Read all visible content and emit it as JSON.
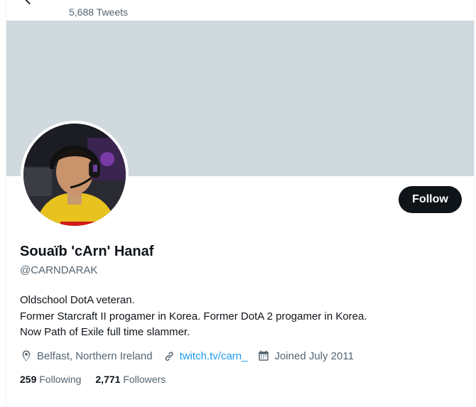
{
  "header": {
    "tweet_count": "5,688 Tweets",
    "back_icon": "arrow-left-icon"
  },
  "banner": {
    "color": "#cfd9de"
  },
  "profile": {
    "display_name": "Souaïb 'cArn' Hanaf",
    "handle": "@CARNDARAK",
    "follow_label": "Follow",
    "bio_lines": [
      "Oldschool DotA veteran.",
      "Former Starcraft II progamer in Korea. Former DotA 2 progamer in Korea.",
      "Now Path of Exile full time slammer."
    ],
    "location": "Belfast, Northern Ireland",
    "website": "twitch.tv/carn_",
    "joined": "Joined July 2011",
    "following_count": "259",
    "following_label": "Following",
    "followers_count": "2,771",
    "followers_label": "Followers"
  },
  "colors": {
    "accent_link": "#1d9bf0",
    "button_bg": "#0f1419",
    "secondary_text": "#536471"
  }
}
